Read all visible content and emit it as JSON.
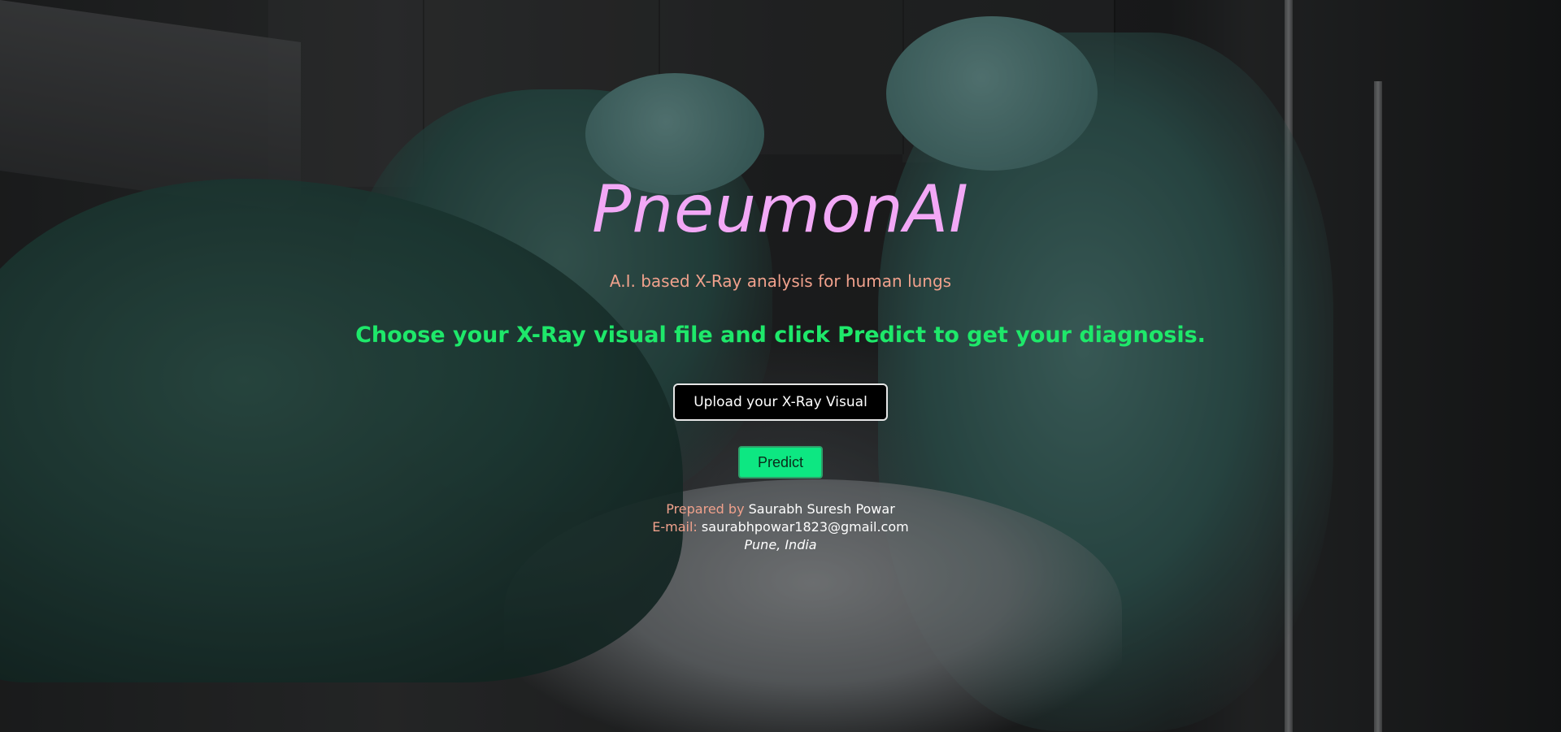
{
  "app": {
    "title": "PneumonAI",
    "subtitle": "A.I. based X-Ray analysis for human lungs",
    "instruction": "Choose your X-Ray visual file and click Predict to get your diagnosis."
  },
  "actions": {
    "upload_label": "Upload your X-Ray Visual",
    "predict_label": "Predict"
  },
  "credits": {
    "prepared_by_label": "Prepared by",
    "author": "Saurabh Suresh Powar",
    "email_label": "E-mail:",
    "email": "saurabhpowar1823@gmail.com",
    "location": "Pune, India"
  },
  "colors": {
    "title": "#f2a8f6",
    "subtitle": "#f0a18c",
    "instruction": "#1ee86a",
    "predict_button": "#0de782",
    "upload_button": "#000000"
  },
  "background": {
    "description_icon": "operating-room-photo"
  }
}
